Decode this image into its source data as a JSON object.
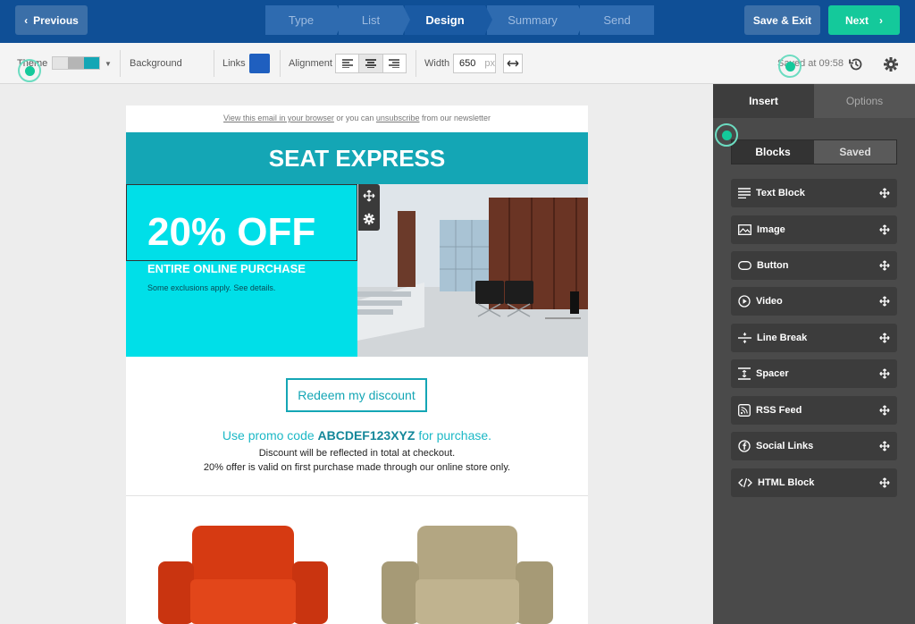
{
  "topbar": {
    "previous_label": "Previous",
    "steps": [
      {
        "label": "Type"
      },
      {
        "label": "List"
      },
      {
        "label": "Design"
      },
      {
        "label": "Summary"
      },
      {
        "label": "Send"
      }
    ],
    "active_step": "Design",
    "save_exit_label": "Save & Exit",
    "next_label": "Next",
    "colors": {
      "bar": "#0f4f96",
      "next": "#14c99b"
    }
  },
  "toolbar": {
    "theme_label": "Theme",
    "theme_swatches": [
      "#e4e4e4",
      "#b5b5b5",
      "#14a6b5"
    ],
    "background_label": "Background",
    "links_label": "Links",
    "links_color": "#1f5fbf",
    "alignment_label": "Alignment",
    "alignment_selected": "center",
    "width_label": "Width",
    "width_value": "650",
    "width_unit": "px",
    "saved_text": "Saved at 09:58"
  },
  "email": {
    "preheader": {
      "view_link": "View this email in your browser",
      "middle": " or you can ",
      "unsubscribe_link": "unsubscribe",
      "end": " from our newsletter"
    },
    "header_title": "SEAT EXPRESS",
    "hero": {
      "headline": "20% OFF",
      "subheadline": "ENTIRE ONLINE PURCHASE",
      "fine_print": "Some exclusions apply. See details."
    },
    "cta_label": "Redeem my discount",
    "promo": {
      "prefix": "Use promo code ",
      "code": "ABCDEF123XYZ",
      "suffix": " for purchase."
    },
    "note_1": "Discount will be reflected in total at checkout.",
    "note_2": "20% offer is valid on first purchase made through our online store only.",
    "colors": {
      "header": "#14a6b5",
      "hero": "#00dfe8"
    }
  },
  "sidebar": {
    "tabs": [
      "Insert",
      "Options"
    ],
    "active_tab": "Insert",
    "segments": [
      "Blocks",
      "Saved"
    ],
    "active_segment": "Blocks",
    "blocks": [
      {
        "label": "Text Block",
        "icon": "text-lines-icon"
      },
      {
        "label": "Image",
        "icon": "image-icon"
      },
      {
        "label": "Button",
        "icon": "button-shape-icon"
      },
      {
        "label": "Video",
        "icon": "play-icon"
      },
      {
        "label": "Line Break",
        "icon": "line-break-icon"
      },
      {
        "label": "Spacer",
        "icon": "spacer-icon"
      },
      {
        "label": "RSS Feed",
        "icon": "rss-icon"
      },
      {
        "label": "Social Links",
        "icon": "facebook-icon"
      },
      {
        "label": "HTML Block",
        "icon": "code-icon"
      }
    ]
  }
}
